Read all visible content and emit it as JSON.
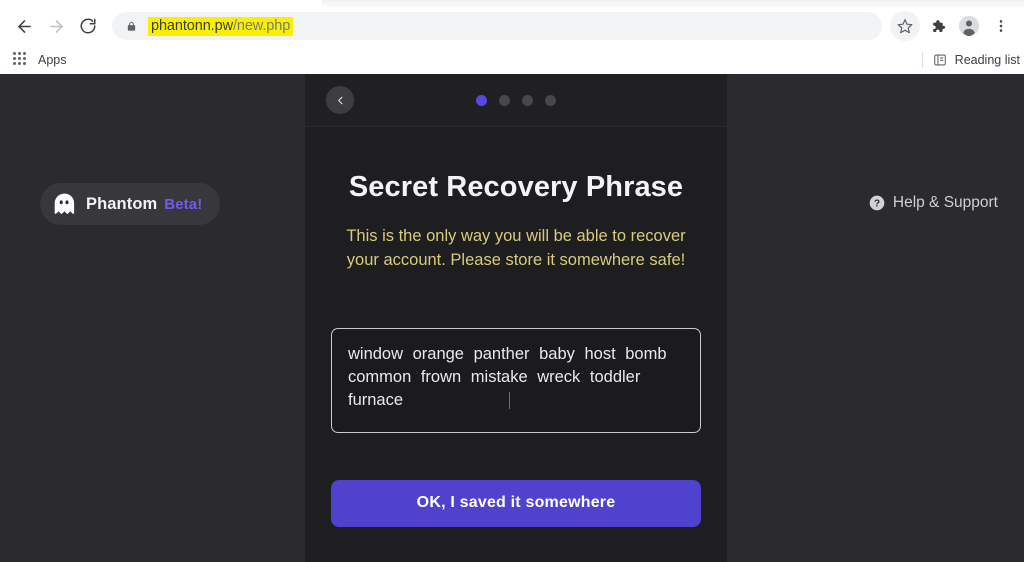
{
  "browser": {
    "back_label": "Back",
    "forward_label": "Forward",
    "reload_label": "Reload",
    "url_host": "phantonn.pw",
    "url_path": "/new.php",
    "url_full": "phantonn.pw/new.php",
    "lock_icon": "lock-icon",
    "star_icon": "bookmark-star-icon",
    "extensions_icon": "puzzle-piece-icon",
    "profile_icon": "profile-avatar-icon",
    "menu_icon": "three-dot-menu-icon",
    "bookmarks": {
      "apps_label": "Apps",
      "apps_icon": "apps-grid-icon",
      "reading_list_label": "Reading list",
      "reading_list_icon": "reading-list-icon"
    }
  },
  "page": {
    "brand": {
      "icon": "phantom-ghost-icon",
      "name": "Phantom",
      "beta": "Beta!"
    },
    "help": {
      "icon": "help-question-icon",
      "label": "Help & Support"
    }
  },
  "modal": {
    "back_icon": "chevron-left-icon",
    "steps": {
      "total": 4,
      "active_index": 0
    },
    "title": "Secret Recovery Phrase",
    "warning": "This is the only way you will be able to recover your account. Please store it somewhere safe!",
    "seed_phrase": "window orange panther baby host bomb common frown mistake wreck toddler furnace",
    "seed_words": [
      "window",
      "orange",
      "panther",
      "baby",
      "host",
      "bomb",
      "common",
      "frown",
      "mistake",
      "wreck",
      "toddler",
      "furnace"
    ],
    "cta_label": "OK, I saved it somewhere"
  },
  "colors": {
    "page_bg": "#2b2b2f",
    "modal_bg": "#1e1e20",
    "accent_purple": "#4f43cd",
    "dot_active": "#5a46e0",
    "brand_beta": "#6f5bf0",
    "warning_text": "#d9cb7c",
    "url_highlight": "#f9f000"
  }
}
